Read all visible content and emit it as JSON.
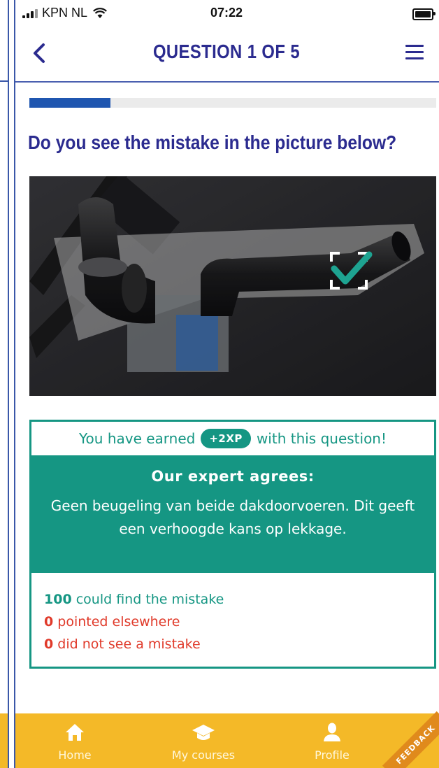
{
  "status": {
    "carrier": "KPN NL",
    "time": "07:22"
  },
  "nav": {
    "title": "QUESTION 1 OF 5"
  },
  "progress": {
    "current": 1,
    "total": 5,
    "fraction": 0.2
  },
  "question": {
    "text": "Do you see the mistake in the picture below?"
  },
  "result": {
    "earned_prefix": "You have earned",
    "xp_badge": "+2XP",
    "earned_suffix": "with this question!",
    "expert_title": "Our expert agrees:",
    "expert_text": "Geen beugeling van beide dakdoorvoeren. Dit geeft een verhoogde kans op lekkage.",
    "stats": [
      {
        "count": "100",
        "label": "could find the mistake",
        "tone": "green"
      },
      {
        "count": "0",
        "label": "pointed elsewhere",
        "tone": "red"
      },
      {
        "count": "0",
        "label": "did not see a mistake",
        "tone": "red"
      }
    ]
  },
  "bottom_nav": [
    {
      "label": "Home",
      "icon": "home-icon"
    },
    {
      "label": "My courses",
      "icon": "graduation-cap-icon"
    },
    {
      "label": "Profile",
      "icon": "person-icon"
    }
  ],
  "feedback": {
    "label": "FEEDBACK"
  },
  "colors": {
    "accent": "#159683",
    "title": "#2b2b8f",
    "progress": "#1f56b0",
    "bottom_bar": "#f4b928",
    "error": "#e03a2a"
  }
}
